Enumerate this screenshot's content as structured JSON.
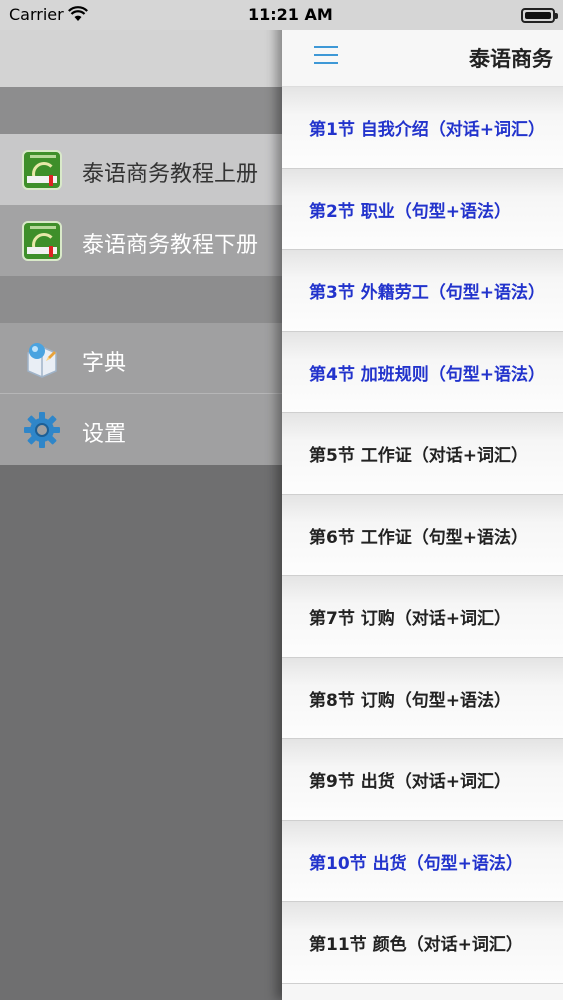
{
  "status_bar": {
    "carrier": "Carrier",
    "time": "11:21 AM"
  },
  "side_menu": {
    "items": [
      {
        "label": "泰语商务教程上册",
        "icon": "book-cover-icon"
      },
      {
        "label": "泰语商务教程下册",
        "icon": "book-cover-icon"
      },
      {
        "label": "字典",
        "icon": "dictionary-icon"
      },
      {
        "label": "设置",
        "icon": "gear-icon"
      }
    ]
  },
  "navbar": {
    "title": "泰语商务"
  },
  "lessons": [
    {
      "title": "第1节 自我介绍（对话+词汇）",
      "color": "blue"
    },
    {
      "title": "第2节 职业（句型+语法）",
      "color": "blue"
    },
    {
      "title": "第3节 外籍劳工（句型+语法）",
      "color": "blue"
    },
    {
      "title": "第4节 加班规则（句型+语法）",
      "color": "blue"
    },
    {
      "title": "第5节 工作证（对话+词汇）",
      "color": "dark"
    },
    {
      "title": "第6节 工作证（句型+语法）",
      "color": "dark"
    },
    {
      "title": "第7节 订购（对话+词汇）",
      "color": "dark"
    },
    {
      "title": "第8节 订购（句型+语法）",
      "color": "dark"
    },
    {
      "title": "第9节 出货（对话+词汇）",
      "color": "dark"
    },
    {
      "title": "第10节 出货（句型+语法）",
      "color": "blue"
    },
    {
      "title": "第11节 颜色（对话+词汇）",
      "color": "dark"
    }
  ],
  "colors": {
    "link_blue": "#2233cc",
    "menu_icon_blue": "#3e98d6",
    "drawer_bg": "#6f6f70"
  }
}
